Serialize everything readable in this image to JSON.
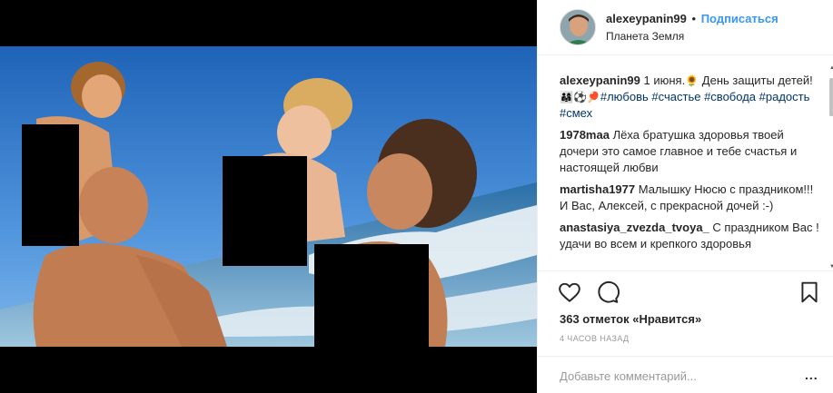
{
  "post": {
    "username": "alexeypanin99",
    "separator": "•",
    "follow_label": "Подписаться",
    "location": "Планета Земля"
  },
  "caption": {
    "username": "alexeypanin99",
    "text_before_emoji": "1 июня.",
    "text_mid": "День защиты детей!",
    "tags": [
      "#любовь",
      "#счастье",
      "#свобода",
      "#радость",
      "#смех"
    ]
  },
  "comments": [
    {
      "user": "1978maa",
      "text": "Лёха братушка здоровья твоей дочери это самое главное и тебе счастья и настоящей любви"
    },
    {
      "user": "martisha1977",
      "text": "Малышку Нюсю с праздником!!! И Вас, Алексей, с прекрасной дочей :-)"
    },
    {
      "user": "anastasiya_zvezda_tvoya_",
      "text": "С праздником Вас !удачи во всем и крепкого здоровья"
    }
  ],
  "likes": "363 отметок «Нравится»",
  "time_ago": "4 ЧАСОВ НАЗАД",
  "comment_input": {
    "placeholder": "Добавьте комментарий..."
  },
  "more_options": "...",
  "icons": [
    "heart-icon",
    "comment-icon",
    "bookmark-icon",
    "scroll-up-arrow-icon",
    "scroll-down-arrow-icon"
  ],
  "colors": {
    "follow_blue": "#3897f0",
    "hashtag": "#003569",
    "muted": "#999999",
    "border": "#efefef"
  }
}
